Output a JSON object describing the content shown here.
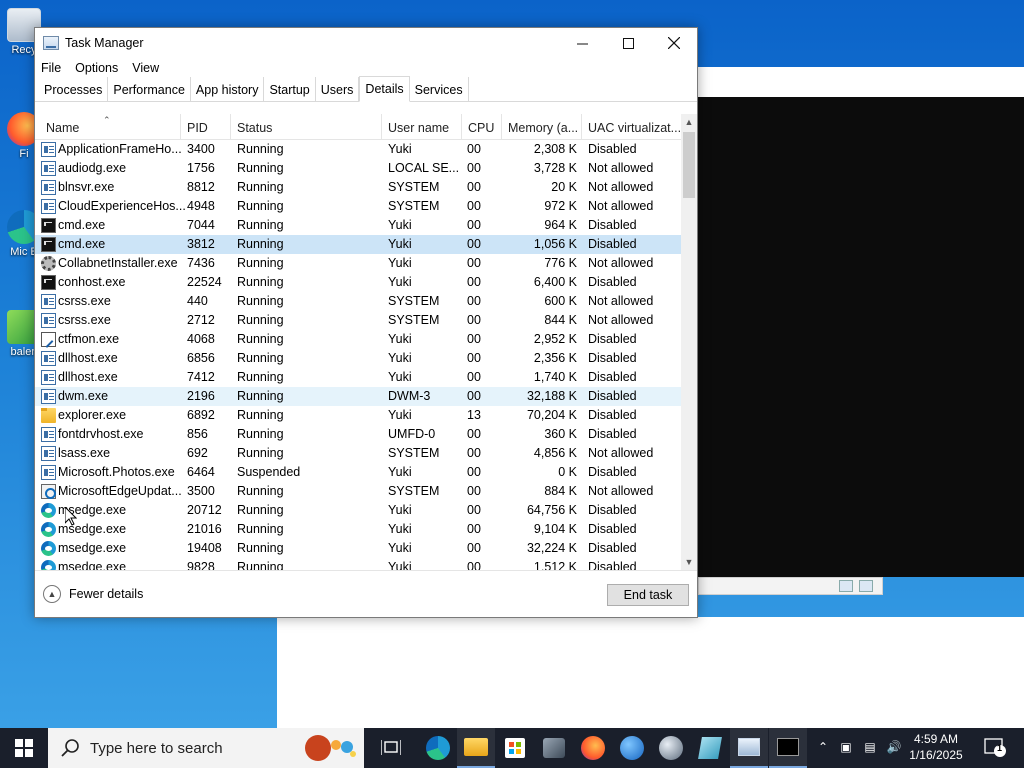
{
  "window": {
    "title": "Task Manager"
  },
  "menu": [
    "File",
    "Options",
    "View"
  ],
  "tabs": [
    "Processes",
    "Performance",
    "App history",
    "Startup",
    "Users",
    "Details",
    "Services"
  ],
  "active_tab": "Details",
  "columns": {
    "name": "Name",
    "pid": "PID",
    "status": "Status",
    "user": "User name",
    "cpu": "CPU",
    "memory": "Memory (a...",
    "uac": "UAC virtualizat..."
  },
  "rows": [
    {
      "icon": "app-icon",
      "name": "ApplicationFrameHo...",
      "pid": "3400",
      "status": "Running",
      "user": "Yuki",
      "cpu": "00",
      "memory": "2,308 K",
      "uac": "Disabled"
    },
    {
      "icon": "app-icon",
      "name": "audiodg.exe",
      "pid": "1756",
      "status": "Running",
      "user": "LOCAL SE...",
      "cpu": "00",
      "memory": "3,728 K",
      "uac": "Not allowed"
    },
    {
      "icon": "app-icon",
      "name": "blnsvr.exe",
      "pid": "8812",
      "status": "Running",
      "user": "SYSTEM",
      "cpu": "00",
      "memory": "20 K",
      "uac": "Not allowed"
    },
    {
      "icon": "app-icon",
      "name": "CloudExperienceHos...",
      "pid": "4948",
      "status": "Running",
      "user": "SYSTEM",
      "cpu": "00",
      "memory": "972 K",
      "uac": "Not allowed"
    },
    {
      "icon": "cmd-icon",
      "name": "cmd.exe",
      "pid": "7044",
      "status": "Running",
      "user": "Yuki",
      "cpu": "00",
      "memory": "964 K",
      "uac": "Disabled"
    },
    {
      "icon": "cmd-icon",
      "name": "cmd.exe",
      "pid": "3812",
      "status": "Running",
      "user": "Yuki",
      "cpu": "00",
      "memory": "1,056 K",
      "uac": "Disabled",
      "selected": true
    },
    {
      "icon": "gear-icon",
      "name": "CollabnetInstaller.exe",
      "pid": "7436",
      "status": "Running",
      "user": "Yuki",
      "cpu": "00",
      "memory": "776 K",
      "uac": "Not allowed"
    },
    {
      "icon": "cmd-icon",
      "name": "conhost.exe",
      "pid": "22524",
      "status": "Running",
      "user": "Yuki",
      "cpu": "00",
      "memory": "6,400 K",
      "uac": "Disabled"
    },
    {
      "icon": "app-icon",
      "name": "csrss.exe",
      "pid": "440",
      "status": "Running",
      "user": "SYSTEM",
      "cpu": "00",
      "memory": "600 K",
      "uac": "Not allowed"
    },
    {
      "icon": "app-icon",
      "name": "csrss.exe",
      "pid": "2712",
      "status": "Running",
      "user": "SYSTEM",
      "cpu": "00",
      "memory": "844 K",
      "uac": "Not allowed"
    },
    {
      "icon": "notepad-icon",
      "name": "ctfmon.exe",
      "pid": "4068",
      "status": "Running",
      "user": "Yuki",
      "cpu": "00",
      "memory": "2,952 K",
      "uac": "Disabled"
    },
    {
      "icon": "app-icon",
      "name": "dllhost.exe",
      "pid": "6856",
      "status": "Running",
      "user": "Yuki",
      "cpu": "00",
      "memory": "2,356 K",
      "uac": "Disabled"
    },
    {
      "icon": "app-icon",
      "name": "dllhost.exe",
      "pid": "7412",
      "status": "Running",
      "user": "Yuki",
      "cpu": "00",
      "memory": "1,740 K",
      "uac": "Disabled"
    },
    {
      "icon": "app-icon",
      "name": "dwm.exe",
      "pid": "2196",
      "status": "Running",
      "user": "DWM-3",
      "cpu": "00",
      "memory": "32,188 K",
      "uac": "Disabled",
      "hover": true
    },
    {
      "icon": "folder-icon",
      "name": "explorer.exe",
      "pid": "6892",
      "status": "Running",
      "user": "Yuki",
      "cpu": "13",
      "memory": "70,204 K",
      "uac": "Disabled"
    },
    {
      "icon": "app-icon",
      "name": "fontdrvhost.exe",
      "pid": "856",
      "status": "Running",
      "user": "UMFD-0",
      "cpu": "00",
      "memory": "360 K",
      "uac": "Disabled"
    },
    {
      "icon": "app-icon",
      "name": "lsass.exe",
      "pid": "692",
      "status": "Running",
      "user": "SYSTEM",
      "cpu": "00",
      "memory": "4,856 K",
      "uac": "Not allowed"
    },
    {
      "icon": "app-icon",
      "name": "Microsoft.Photos.exe",
      "pid": "6464",
      "status": "Suspended",
      "user": "Yuki",
      "cpu": "00",
      "memory": "0 K",
      "uac": "Disabled"
    },
    {
      "icon": "edge-update-icon",
      "name": "MicrosoftEdgeUpdat...",
      "pid": "3500",
      "status": "Running",
      "user": "SYSTEM",
      "cpu": "00",
      "memory": "884 K",
      "uac": "Not allowed"
    },
    {
      "icon": "edge-icon",
      "name": "msedge.exe",
      "pid": "20712",
      "status": "Running",
      "user": "Yuki",
      "cpu": "00",
      "memory": "64,756 K",
      "uac": "Disabled"
    },
    {
      "icon": "edge-icon",
      "name": "msedge.exe",
      "pid": "21016",
      "status": "Running",
      "user": "Yuki",
      "cpu": "00",
      "memory": "9,104 K",
      "uac": "Disabled"
    },
    {
      "icon": "edge-icon",
      "name": "msedge.exe",
      "pid": "19408",
      "status": "Running",
      "user": "Yuki",
      "cpu": "00",
      "memory": "32,224 K",
      "uac": "Disabled"
    },
    {
      "icon": "edge-icon",
      "name": "msedge.exe",
      "pid": "9828",
      "status": "Running",
      "user": "Yuki",
      "cpu": "00",
      "memory": "1,512 K",
      "uac": "Disabled"
    }
  ],
  "footer": {
    "fewer_details": "Fewer details",
    "end_task": "End task"
  },
  "taskbar": {
    "search_placeholder": "Type here to search",
    "time": "4:59 AM",
    "date": "1/16/2025",
    "notification_count": "1"
  },
  "desktop": {
    "icon_labels": [
      "Recy",
      "Fi",
      "Mic E",
      "balen"
    ]
  },
  "colors": {
    "selected_row": "#cce4f7",
    "hover_row": "#e5f3fb",
    "taskbar": "#1a1f2b",
    "desktop": "#1b7fd6"
  }
}
